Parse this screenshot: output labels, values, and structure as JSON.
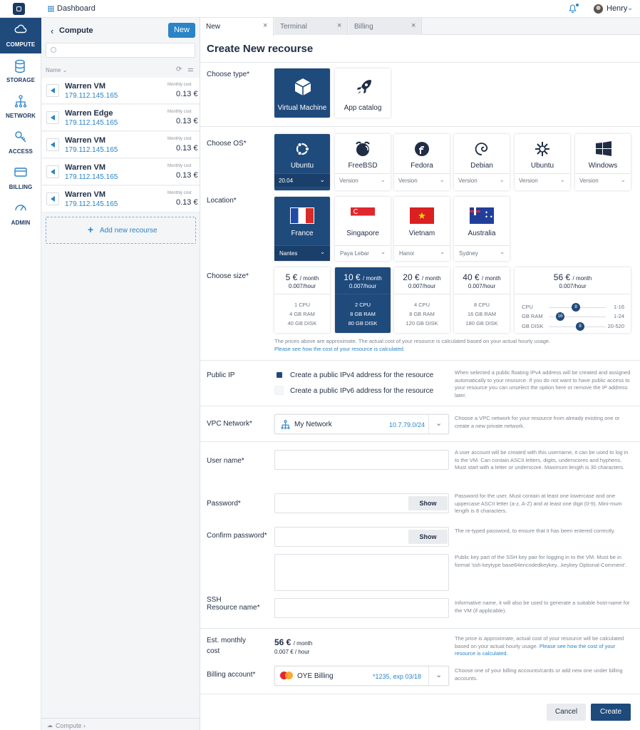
{
  "topbar": {
    "app_title": "Dashboard",
    "user_name": "Henry"
  },
  "nav": [
    {
      "label": "COMPUTE",
      "icon": "cloud-icon",
      "active": true
    },
    {
      "label": "STORAGE",
      "icon": "database-icon"
    },
    {
      "label": "NETWORK",
      "icon": "network-icon"
    },
    {
      "label": "ACCESS",
      "icon": "key-icon"
    },
    {
      "label": "BILLING",
      "icon": "credit-card-icon"
    },
    {
      "label": "ADMIN",
      "icon": "gauge-icon"
    }
  ],
  "list": {
    "title": "Compute",
    "new_label": "New",
    "col_name": "Name",
    "monthly_cost_label": "Monthly cost",
    "rows": [
      {
        "name": "Warren VM",
        "ip": "179.112.145.165",
        "price": "0.13 €"
      },
      {
        "name": "Warren Edge",
        "ip": "179.112.145.165",
        "price": "0.13 €"
      },
      {
        "name": "Warren VM",
        "ip": "179.112.145.165",
        "price": "0.13 €"
      },
      {
        "name": "Warren VM",
        "ip": "179.112.145.165",
        "price": "0.13 €"
      },
      {
        "name": "Warren VM",
        "ip": "179.112.145.165",
        "price": "0.13 €"
      }
    ],
    "add_label": "Add new recourse",
    "footer_label": "Compute"
  },
  "tabs": [
    {
      "label": "New"
    },
    {
      "label": "Terminal"
    },
    {
      "label": "Billing"
    }
  ],
  "form": {
    "title": "Create New recourse",
    "type_label": "Choose type*",
    "types": [
      {
        "label": "Virtual Machine"
      },
      {
        "label": "App catalog"
      }
    ],
    "os_label": "Choose OS*",
    "os": [
      {
        "name": "Ubuntu",
        "version": "20.04"
      },
      {
        "name": "FreeBSD",
        "version": "Version"
      },
      {
        "name": "Fedora",
        "version": "Version"
      },
      {
        "name": "Debian",
        "version": "Version"
      },
      {
        "name": "Ubuntu",
        "version": "Version"
      },
      {
        "name": "Windows",
        "version": "Version"
      }
    ],
    "location_label": "Location*",
    "locations": [
      {
        "country": "France",
        "city": "Nantes"
      },
      {
        "country": "Singapore",
        "city": "Paya Lebar"
      },
      {
        "country": "Vietnam",
        "city": "Hanoi"
      },
      {
        "country": "Australia",
        "city": "Sydney"
      }
    ],
    "size_label": "Choose size*",
    "per_month": "/ month",
    "sizes": [
      {
        "price": "5 €",
        "hour": "0.007/hour",
        "cpu": "1 CPU",
        "ram": "4 GB RAM",
        "disk": "40 GB DISK"
      },
      {
        "price": "10 €",
        "hour": "0.007/hour",
        "cpu": "2 CPU",
        "ram": "8 GB RAM",
        "disk": "80 GB DISK"
      },
      {
        "price": "20 €",
        "hour": "0.007/hour",
        "cpu": "4 CPU",
        "ram": "8 GB RAM",
        "disk": "120 GB DISK"
      },
      {
        "price": "40 €",
        "hour": "0.007/hour",
        "cpu": "8 CPU",
        "ram": "16 GB RAM",
        "disk": "180 GB DISK"
      }
    ],
    "custom": {
      "price": "56 €",
      "hour": "0.007/hour",
      "sliders": [
        {
          "label": "CPU",
          "value": "8",
          "range": "1-16",
          "fraction": 0.47
        },
        {
          "label": "GB RAM",
          "value": "16",
          "range": "1-24",
          "fraction": 0.2
        },
        {
          "label": "GB DISK",
          "value": "8",
          "range": "20-520",
          "fraction": 0.55
        }
      ]
    },
    "size_note": "The prices above are approximate. The actual cost of your resource is calculated based on your actual hourly usage.",
    "size_link": "Please see how the cost of your resource is calculated.",
    "public_ip_label": "Public IP",
    "ipv4_label": "Create a public IPv4 address for the resource",
    "ipv6_label": "Create a public IPv6 address for the resource",
    "ip_help": "When selected a public floating IPv4 address will be created and assigned automatically to your resource. If you do not want to have public access to your resource you can unselect the option here or remove the IP address later.",
    "vpc_label": "VPC Network*",
    "vpc_name": "My Network",
    "vpc_cidr": "10.7.79.0/24",
    "vpc_help": "Choose a VPC network for your resource from already existing one or create a new private network.",
    "username_label": "User name*",
    "username_help": "A user account will be created with this username, it can be used to log in to the VM. Can contain ASCII letters, digits, underscores and hyphens. Must start with a letter or underscore. Maximum length is 30 characters.",
    "password_label": "Password*",
    "password_help": "Password for the user. Must contain at least one lowercase and one uppercase ASCII letter (a-z, A-Z) and at least one digit (0-9). Mini-mum length is 8 characters.",
    "confirm_label": "Confirm password*",
    "confirm_help": "The re-typed password, to ensure that it has been entered correctly.",
    "show_label": "Show",
    "ssh_help": "Public key part of the SSH key pair for logging in to the VM. Must be in format 'ssh-keytype base64encodedkeykey...keykey Optional-Comment'.",
    "ssh_label": "SSH",
    "resname_label": "Resource name*",
    "resname_help": "Informative name, it will also be used to generate a suitable host-name for the VM (if applicable).",
    "est_label_1": "Est. monthly",
    "est_label_2": "cost",
    "est_price": "56 €",
    "est_hour": "0.007 € / hour",
    "est_help": "The price is approximate, actual cost of your resource will be calculated based on your actual hourly usage.",
    "est_link": "Please see how the cost of your resource is calculated.",
    "billing_label": "Billing account*",
    "billing_name": "OYE Billing",
    "billing_card": "*1235, exp 03/18",
    "billing_help": "Choose one of your billing accounts/cards or add new one under billing accounts.",
    "cancel_label": "Cancel",
    "create_label": "Create"
  },
  "colors": {
    "accent": "#2a84c7",
    "navy": "#1f4a7c"
  }
}
